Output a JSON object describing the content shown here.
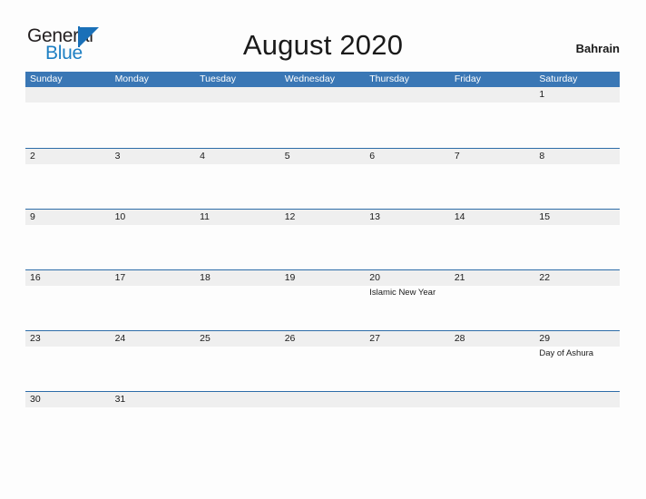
{
  "brand": {
    "name_part1": "General",
    "name_part2": "Blue",
    "triangle_color": "#1a70b8",
    "text_color": "#231f20",
    "accent_color": "#1d7fc3"
  },
  "header": {
    "title": "August 2020",
    "country": "Bahrain"
  },
  "theme": {
    "header_bar_color": "#3a77b5",
    "row_divider_color": "#2d6ca8",
    "daynum_band_color": "#efefef",
    "page_background": "#fdfdfd"
  },
  "weekdays": [
    "Sunday",
    "Monday",
    "Tuesday",
    "Wednesday",
    "Thursday",
    "Friday",
    "Saturday"
  ],
  "weeks": [
    [
      {
        "day": ""
      },
      {
        "day": ""
      },
      {
        "day": ""
      },
      {
        "day": ""
      },
      {
        "day": ""
      },
      {
        "day": ""
      },
      {
        "day": "1"
      }
    ],
    [
      {
        "day": "2"
      },
      {
        "day": "3"
      },
      {
        "day": "4"
      },
      {
        "day": "5"
      },
      {
        "day": "6"
      },
      {
        "day": "7"
      },
      {
        "day": "8"
      }
    ],
    [
      {
        "day": "9"
      },
      {
        "day": "10"
      },
      {
        "day": "11"
      },
      {
        "day": "12"
      },
      {
        "day": "13"
      },
      {
        "day": "14"
      },
      {
        "day": "15"
      }
    ],
    [
      {
        "day": "16"
      },
      {
        "day": "17"
      },
      {
        "day": "18"
      },
      {
        "day": "19"
      },
      {
        "day": "20",
        "holiday": "Islamic New Year"
      },
      {
        "day": "21"
      },
      {
        "day": "22"
      }
    ],
    [
      {
        "day": "23"
      },
      {
        "day": "24"
      },
      {
        "day": "25"
      },
      {
        "day": "26"
      },
      {
        "day": "27"
      },
      {
        "day": "28"
      },
      {
        "day": "29",
        "holiday": "Day of Ashura"
      }
    ],
    [
      {
        "day": "30"
      },
      {
        "day": "31"
      },
      {
        "day": ""
      },
      {
        "day": ""
      },
      {
        "day": ""
      },
      {
        "day": ""
      },
      {
        "day": ""
      }
    ]
  ]
}
